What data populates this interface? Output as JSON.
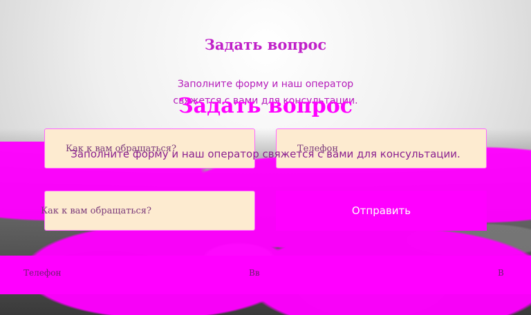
{
  "header": {
    "title_primary": "Задать вопрос",
    "subtitle_primary": "Заполните форму и наш оператор свяжется с вами для консультации.",
    "title_secondary": "Задать вопрос",
    "subtitle_secondary": "Заполните форму и наш оператор свяжется с вами для консультации."
  },
  "form": {
    "name_placeholder": "Как к вам обращаться?",
    "phone_placeholder": "Телефон",
    "name_placeholder_2": "Как к вам обращаться?",
    "submit_label": "Отправить"
  },
  "band": {
    "label_left": "Телефон",
    "label_center": "Вв",
    "label_right": "В"
  },
  "colors": {
    "accent": "#ff00ff",
    "input_bg": "#fdebd0",
    "title_color": "#c020c8"
  }
}
